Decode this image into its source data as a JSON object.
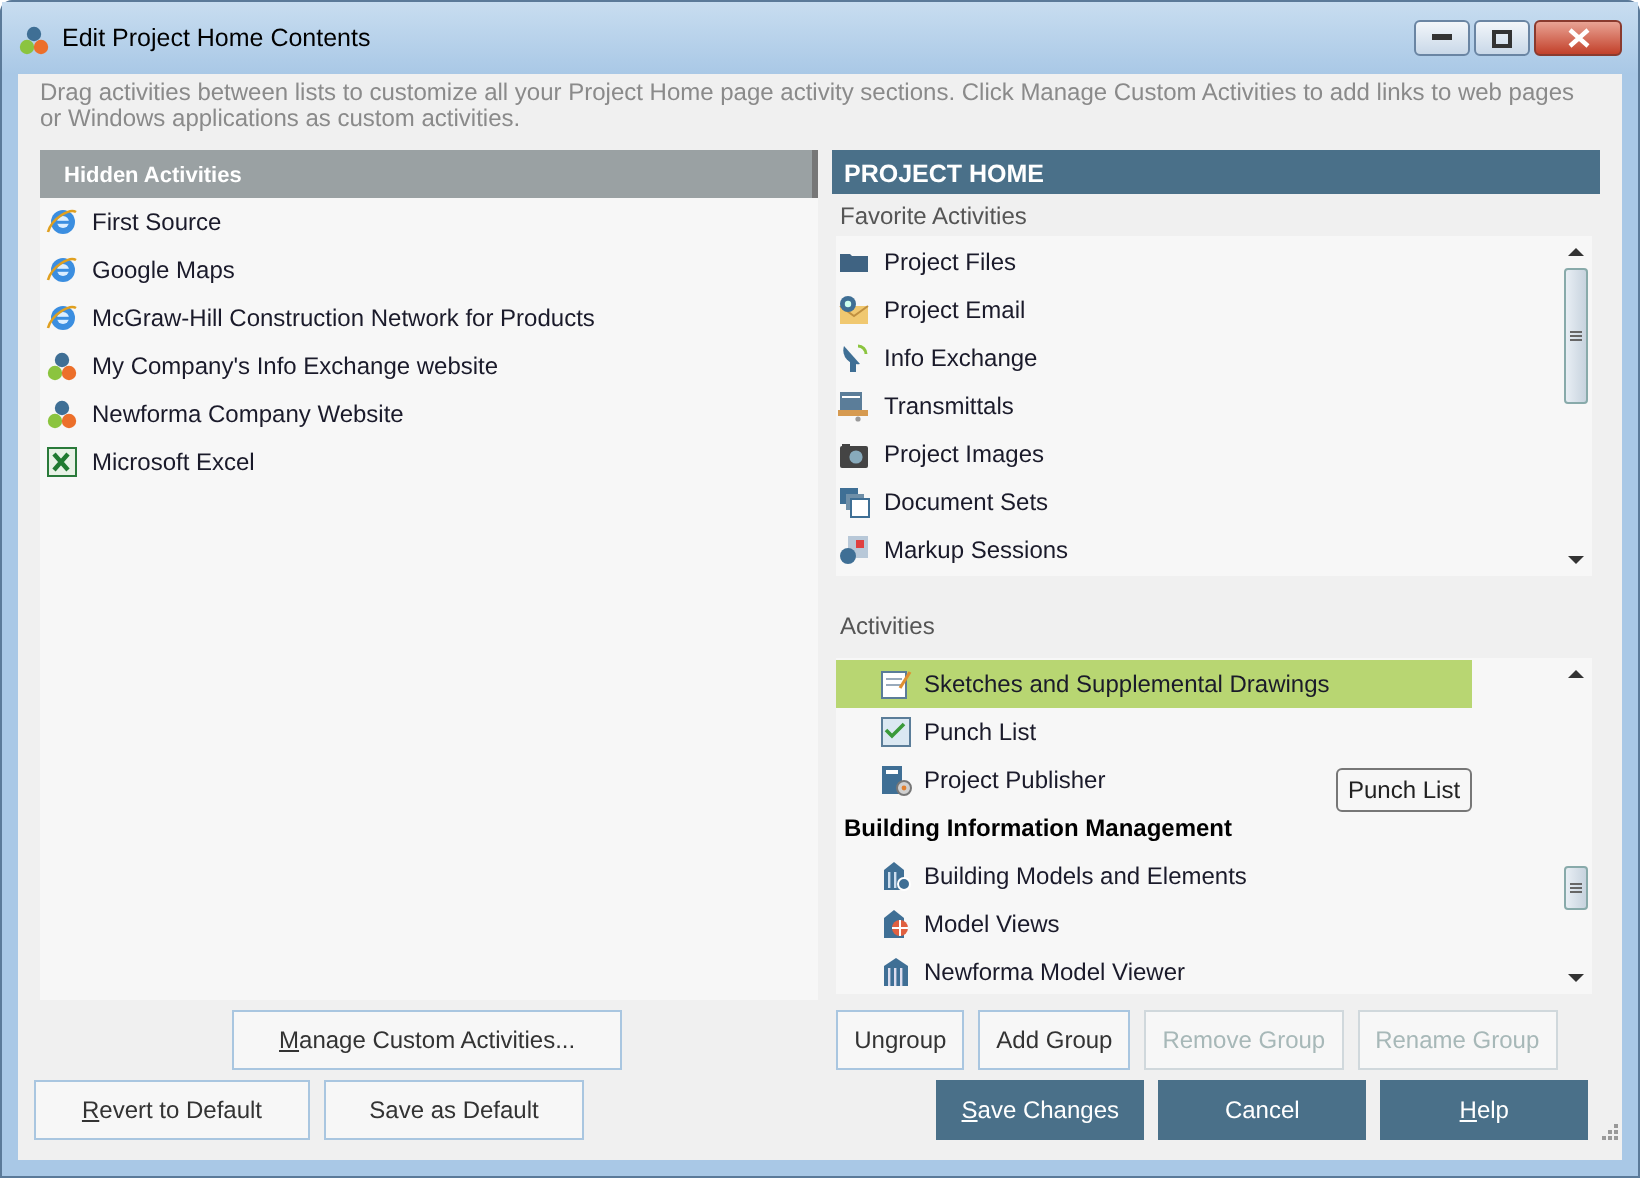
{
  "window": {
    "title": "Edit Project Home Contents"
  },
  "instructions": "Drag activities between lists to customize all your Project Home page activity sections.  Click Manage Custom Activities to add links to web pages or Windows applications as custom activities.",
  "hidden": {
    "header": "Hidden Activities",
    "items": [
      {
        "label": "First Source"
      },
      {
        "label": "Google Maps"
      },
      {
        "label": "McGraw-Hill Construction Network for Products"
      },
      {
        "label": "My Company's Info Exchange website"
      },
      {
        "label": "Newforma Company Website"
      },
      {
        "label": "Microsoft Excel"
      }
    ]
  },
  "project_home": {
    "header": "PROJECT HOME",
    "favorites_label": "Favorite Activities",
    "favorites": [
      {
        "label": "Project Files"
      },
      {
        "label": "Project Email"
      },
      {
        "label": "Info Exchange"
      },
      {
        "label": "Transmittals"
      },
      {
        "label": "Project Images"
      },
      {
        "label": "Document Sets"
      },
      {
        "label": "Markup Sessions"
      }
    ],
    "activities_label": "Activities",
    "activities": [
      {
        "kind": "item",
        "label": "Sketches and Supplemental Drawings",
        "selected": true
      },
      {
        "kind": "item",
        "label": "Punch List",
        "selected": false
      },
      {
        "kind": "item",
        "label": "Project Publisher",
        "selected": false
      },
      {
        "kind": "group",
        "label": "Building Information Management",
        "selected": false
      },
      {
        "kind": "item",
        "label": "Building Models and Elements",
        "selected": false
      },
      {
        "kind": "item",
        "label": "Model Views",
        "selected": false
      },
      {
        "kind": "item",
        "label": "Newforma Model Viewer",
        "selected": false
      }
    ],
    "tooltip": "Punch List"
  },
  "buttons": [
    {
      "label": "Manage Custom Activities...",
      "mnemonic": true,
      "disabled": false,
      "primary": false
    },
    {
      "label": "Ungroup",
      "mnemonic": false,
      "disabled": false,
      "primary": false
    },
    {
      "label": "Add Group",
      "mnemonic": false,
      "disabled": false,
      "primary": false
    },
    {
      "label": "Remove Group",
      "mnemonic": false,
      "disabled": true,
      "primary": false
    },
    {
      "label": "Rename Group",
      "mnemonic": false,
      "disabled": true,
      "primary": false
    },
    {
      "label": "Revert to Default",
      "mnemonic": true,
      "disabled": false,
      "primary": false
    },
    {
      "label": "Save as Default",
      "mnemonic": false,
      "disabled": false,
      "primary": false
    },
    {
      "label": "Save Changes",
      "mnemonic": true,
      "disabled": false,
      "primary": true
    },
    {
      "label": "Cancel",
      "mnemonic": false,
      "disabled": false,
      "primary": true
    },
    {
      "label": "Help",
      "mnemonic": true,
      "disabled": false,
      "primary": true
    }
  ]
}
